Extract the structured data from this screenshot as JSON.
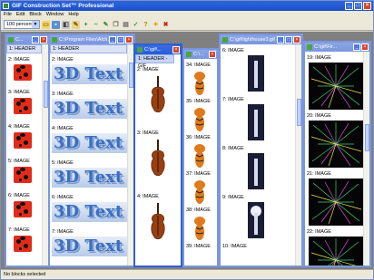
{
  "app": {
    "title": "GIF Construction Set™ Professional",
    "menu": [
      "File",
      "Edit",
      "Block",
      "Window",
      "Help"
    ],
    "toolbar": {
      "zoom": "100 percent"
    },
    "status": "No blocks selected",
    "colors": {
      "title_bar": "#245edb",
      "mdi_background": "#808080",
      "close_button": "#d4462a"
    }
  },
  "windows": [
    {
      "title": "C...",
      "items": [
        "1: HEADER",
        "2: IMAGE",
        "3: IMAGE",
        "4: IMAGE",
        "5: IMAGE",
        "6: IMAGE",
        "7: IMAGE"
      ],
      "image_kind": "ladybug"
    },
    {
      "title": "C:\\Program Files\\Alch...",
      "items": [
        "1: HEADER",
        "2: IMAGE",
        "3: IMAGE",
        "4: IMAGE",
        "5: IMAGE",
        "6: IMAGE",
        "7: IMAGE"
      ],
      "image_text": "3D Text"
    },
    {
      "title": "C:\\gif\\...",
      "header_item": "1: HEADER - GIF",
      "items": [
        "2: IMAGE",
        "3: IMAGE",
        "4: IMAGE"
      ],
      "image_kind": "violin"
    },
    {
      "title": "C:\\...",
      "items": [
        "34: IMAGE",
        "35: IMAGE",
        "36: IMAGE",
        "37: IMAGE",
        "38: IMAGE",
        "39: IMAGE"
      ],
      "image_kind": "tiger"
    },
    {
      "title": "C:\\gif\\lighthouse3.gif ...",
      "items": [
        "6: IMAGE",
        "7: IMAGE",
        "8: IMAGE",
        "9: IMAGE",
        "10: IMAGE"
      ],
      "image_kind": "lighthouse"
    },
    {
      "title": "C:\\gif\\Fir...",
      "items": [
        "19: IMAGE",
        "20: IMAGE",
        "21: IMAGE",
        "22: IMAGE"
      ],
      "image_kind": "fireworks"
    }
  ]
}
